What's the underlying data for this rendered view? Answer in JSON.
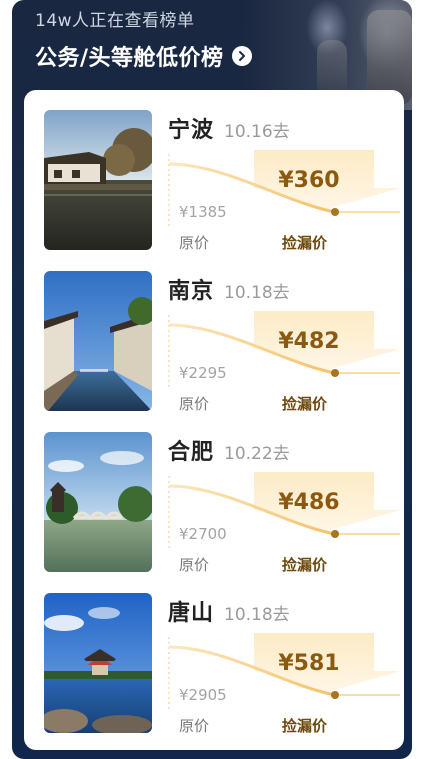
{
  "header": {
    "viewers_text": "14w人正在查看榜单",
    "title": "公务/头等舱低价榜"
  },
  "labels": {
    "original": "原价",
    "deal": "捡漏价"
  },
  "colors": {
    "banner": "#152a4a",
    "sale_price": "#8b5a10",
    "accent_gold": "#f3c26b"
  },
  "deals": [
    {
      "city": "宁波",
      "date": "10.16去",
      "original_price": "¥1385",
      "sale_price": "¥360"
    },
    {
      "city": "南京",
      "date": "10.18去",
      "original_price": "¥2295",
      "sale_price": "¥482"
    },
    {
      "city": "合肥",
      "date": "10.22去",
      "original_price": "¥2700",
      "sale_price": "¥486"
    },
    {
      "city": "唐山",
      "date": "10.18去",
      "original_price": "¥2905",
      "sale_price": "¥581"
    }
  ]
}
